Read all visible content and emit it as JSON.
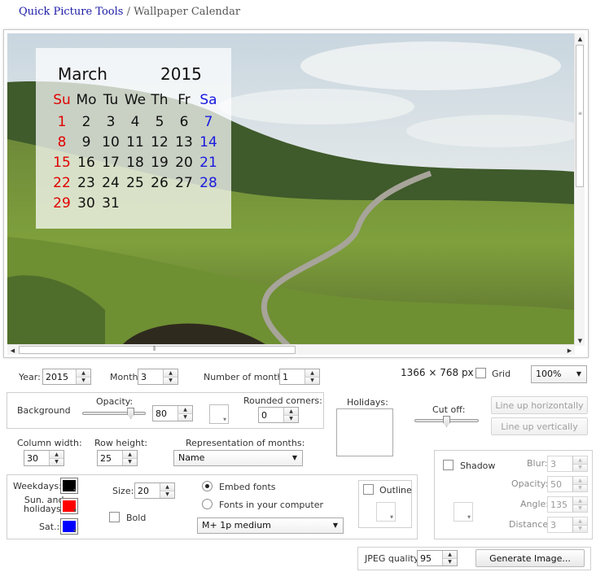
{
  "breadcrumb": {
    "home": "Quick Picture Tools",
    "separator": " / ",
    "current": "Wallpaper Calendar"
  },
  "calendar": {
    "month": "March",
    "year": "2015",
    "weekday_headers": [
      "Su",
      "Mo",
      "Tu",
      "We",
      "Th",
      "Fr",
      "Sa"
    ],
    "days": [
      [
        "1",
        "2",
        "3",
        "4",
        "5",
        "6",
        "7"
      ],
      [
        "8",
        "9",
        "10",
        "11",
        "12",
        "13",
        "14"
      ],
      [
        "15",
        "16",
        "17",
        "18",
        "19",
        "20",
        "21"
      ],
      [
        "22",
        "23",
        "24",
        "25",
        "26",
        "27",
        "28"
      ],
      [
        "29",
        "30",
        "31",
        "",
        "",
        "",
        ""
      ]
    ],
    "weekday_color": "#111111",
    "sunday_color": "#e00000",
    "saturday_color": "#1a1adf"
  },
  "controls": {
    "year_label": "Year:",
    "year_value": "2015",
    "month_label": "Month:",
    "month_value": "3",
    "num_months_label": "Number of months:",
    "num_months_value": "1",
    "resolution": "1366 × 768 px",
    "grid_label": "Grid",
    "zoom_value": "100%",
    "background_label": "Background",
    "opacity_label": "Opacity:",
    "opacity_value": "80",
    "opacity_level": 0.8,
    "rounded_label": "Rounded corners:",
    "rounded_value": "0",
    "holidays_label": "Holidays:",
    "cutoff_label": "Cut off:",
    "line_up_h": "Line up horizontally",
    "line_up_v": "Line up vertically",
    "col_width_label": "Column width:",
    "col_width_value": "30",
    "row_height_label": "Row height:",
    "row_height_value": "25",
    "representation_label": "Representation of  months:",
    "representation_value": "Name",
    "shadow_label": "Shadow",
    "blur_label": "Blur:",
    "blur_value": "3",
    "shadow_opacity_label": "Opacity:",
    "shadow_opacity_value": "50",
    "angle_label": "Angle:",
    "angle_value": "135",
    "distance_label": "Distance:",
    "distance_value": "3",
    "weekdays_label": "Weekdays:",
    "sun_holidays_label_1": "Sun. and",
    "sun_holidays_label_2": "holidays:",
    "sat_label": "Sat.:",
    "weekday_swatch": "#000000",
    "sunday_swatch": "#ff0000",
    "saturday_swatch": "#0000ff",
    "size_label": "Size:",
    "size_value": "20",
    "bold_label": "Bold",
    "embed_fonts_label": "Embed fonts",
    "fonts_computer_label": "Fonts in your computer",
    "font_value": "M+ 1p medium",
    "outline_label": "Outline",
    "jpeg_label": "JPEG quality:",
    "jpeg_value": "95",
    "generate_label": "Generate Image..."
  },
  "colors": {
    "link": "#1a1aa6",
    "accent_red": "#e00000",
    "accent_blue": "#1a1adf"
  }
}
